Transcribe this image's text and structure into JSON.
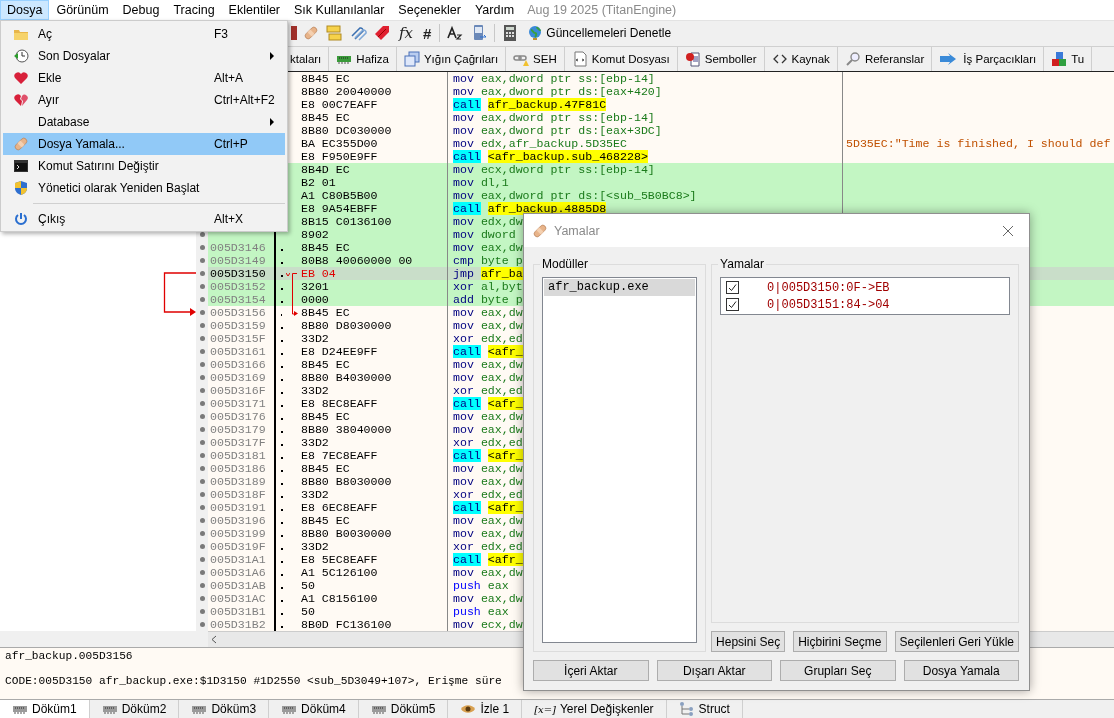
{
  "menu_bar": {
    "items": [
      {
        "label": "Dosya",
        "selected": true
      },
      {
        "label": "Görünüm",
        "selected": false
      },
      {
        "label": "Debug",
        "selected": false
      },
      {
        "label": "Tracing",
        "selected": false
      },
      {
        "label": "Eklentiler",
        "selected": false
      },
      {
        "label": "Sık Kullanılanlar",
        "selected": false
      },
      {
        "label": "Seçenekler",
        "selected": false
      },
      {
        "label": "Yardım",
        "selected": false
      }
    ],
    "build": "Aug 19 2025 (TitanEngine)"
  },
  "file_menu": [
    {
      "kind": "item",
      "label": "Aç",
      "shortcut": "F3",
      "submenu": false,
      "selected": false
    },
    {
      "kind": "item",
      "label": "Son Dosyalar",
      "submenu": true,
      "selected": false
    },
    {
      "kind": "item",
      "label": "Ekle",
      "shortcut": "Alt+A",
      "submenu": false,
      "selected": false
    },
    {
      "kind": "item",
      "label": "Ayır",
      "shortcut": "Ctrl+Alt+F2",
      "submenu": false,
      "selected": false
    },
    {
      "kind": "item",
      "label": "Database",
      "submenu": true,
      "selected": false
    },
    {
      "kind": "item",
      "label": "Dosya Yamala...",
      "shortcut": "Ctrl+P",
      "submenu": false,
      "selected": true
    },
    {
      "kind": "item",
      "label": "Komut Satırını Değiştir",
      "submenu": false,
      "selected": false
    },
    {
      "kind": "item",
      "label": "Yönetici olarak Yeniden Başlat",
      "submenu": false,
      "selected": false
    },
    {
      "kind": "separator"
    },
    {
      "kind": "item",
      "label": "Çıkış",
      "shortcut": "Alt+X",
      "submenu": false,
      "selected": false
    }
  ],
  "toolbar": {
    "glyphs": [
      "fx",
      "#"
    ],
    "update_button": "Güncellemeleri Denetle"
  },
  "top_tabs": [
    "ktaları",
    "Hafiza",
    "Yığın Çağrıları",
    "SEH",
    "Komut Dosyası",
    "Semboller",
    "Kaynak",
    "Referanslar",
    "İş Parçacıkları",
    "Tu"
  ],
  "disassembly": [
    {
      "bytes": "8B45 EC",
      "mnemonic": "mov",
      "operands": "eax,dword ptr ss:[ebp-14]",
      "kind": "plain",
      "traced": false,
      "selected": false,
      "patched": false,
      "jump_from": false,
      "jump_to": false
    },
    {
      "bytes": "8B80 20040000",
      "mnemonic": "mov",
      "operands": "eax,dword ptr ds:[eax+420]",
      "kind": "plain",
      "traced": false,
      "selected": false,
      "patched": false,
      "jump_from": false,
      "jump_to": false
    },
    {
      "bytes": "E8 00C7EAFF",
      "mnemonic": "call",
      "operands": "afr_backup.47F81C",
      "kind": "call",
      "traced": false,
      "selected": false,
      "patched": false,
      "jump_from": false,
      "jump_to": false
    },
    {
      "bytes": "8B45 EC",
      "mnemonic": "mov",
      "operands": "eax,dword ptr ss:[ebp-14]",
      "kind": "plain",
      "traced": false,
      "selected": false,
      "patched": false,
      "jump_from": false,
      "jump_to": false
    },
    {
      "bytes": "8B80 DC030000",
      "mnemonic": "mov",
      "operands": "eax,dword ptr ds:[eax+3DC]",
      "kind": "plain",
      "traced": false,
      "selected": false,
      "patched": false,
      "jump_from": false,
      "jump_to": false
    },
    {
      "bytes": "BA EC355D00",
      "mnemonic": "mov",
      "operands": "edx,afr_backup.5D35EC",
      "kind": "plain",
      "traced": false,
      "selected": false,
      "patched": false,
      "jump_from": false,
      "jump_to": false,
      "comment": "5D35EC:\"Time is finished, I should def"
    },
    {
      "bytes": "E8 F950E9FF",
      "mnemonic": "call",
      "operands": "<afr_backup.sub_468228>",
      "kind": "call",
      "traced": false,
      "selected": false,
      "patched": false,
      "jump_from": false,
      "jump_to": false
    },
    {
      "bytes": "8B4D EC",
      "mnemonic": "mov",
      "operands": "ecx,dword ptr ss:[ebp-14]",
      "kind": "plain",
      "traced": true,
      "selected": false,
      "patched": false,
      "jump_from": false,
      "jump_to": false
    },
    {
      "bytes": "B2 01",
      "mnemonic": "mov",
      "operands": "dl,1",
      "kind": "plain",
      "traced": true,
      "selected": false,
      "patched": false,
      "jump_from": false,
      "jump_to": false
    },
    {
      "bytes": "A1 C80B5B00",
      "mnemonic": "mov",
      "operands": "eax,dword ptr ds:[<sub_5B0BC8>]",
      "kind": "plain",
      "traced": true,
      "selected": false,
      "patched": false,
      "jump_from": false,
      "jump_to": false
    },
    {
      "bytes": "E8 9A54EBFF",
      "mnemonic": "call",
      "operands": "afr_backup.4885D8",
      "kind": "call",
      "traced": true,
      "selected": false,
      "patched": false,
      "jump_from": false,
      "jump_to": false
    },
    {
      "bytes": "8B15 C0136100",
      "mnemonic": "mov",
      "operands": "edx,dw",
      "kind": "plain",
      "traced": true,
      "selected": false,
      "patched": false,
      "jump_from": false,
      "jump_to": false
    },
    {
      "bytes": "8902",
      "mnemonic": "mov",
      "operands": "dword",
      "kind": "plain",
      "traced": true,
      "selected": false,
      "patched": false,
      "jump_from": false,
      "jump_to": false
    },
    {
      "address": "005D3146",
      "bytes": "8B45 EC",
      "mnemonic": "mov",
      "operands": "eax,dw",
      "kind": "plain",
      "traced": true,
      "selected": false,
      "patched": false,
      "jump_from": false,
      "jump_to": false
    },
    {
      "address": "005D3149",
      "bytes": "80B8 40060000 00",
      "mnemonic": "cmp",
      "operands": "byte p",
      "kind": "plain",
      "traced": true,
      "selected": false,
      "patched": false,
      "jump_from": false,
      "jump_to": false
    },
    {
      "address": "005D3150",
      "bytes": "EB 04",
      "mnemonic": "jmp",
      "operands": "afr_ba",
      "kind": "jmp",
      "traced": true,
      "selected": true,
      "patched": true,
      "jump_from": true,
      "jump_to": false
    },
    {
      "address": "005D3152",
      "bytes": "3201",
      "mnemonic": "xor",
      "operands": "al,byt",
      "kind": "plain",
      "traced": true,
      "selected": false,
      "patched": false,
      "jump_from": false,
      "jump_to": false
    },
    {
      "address": "005D3154",
      "bytes": "0000",
      "mnemonic": "add",
      "operands": "byte p",
      "kind": "plain",
      "traced": true,
      "selected": false,
      "patched": false,
      "jump_from": false,
      "jump_to": false
    },
    {
      "address": "005D3156",
      "bytes": "8B45 EC",
      "mnemonic": "mov",
      "operands": "eax,dw",
      "kind": "plain",
      "traced": false,
      "selected": false,
      "patched": false,
      "jump_from": false,
      "jump_to": true
    },
    {
      "address": "005D3159",
      "bytes": "8B80 D8030000",
      "mnemonic": "mov",
      "operands": "eax,dw",
      "kind": "plain",
      "traced": false,
      "selected": false,
      "patched": false,
      "jump_from": false,
      "jump_to": false
    },
    {
      "address": "005D315F",
      "bytes": "33D2",
      "mnemonic": "xor",
      "operands": "edx,ed",
      "kind": "plain",
      "traced": false,
      "selected": false,
      "patched": false,
      "jump_from": false,
      "jump_to": false
    },
    {
      "address": "005D3161",
      "bytes": "E8 D24EE9FF",
      "mnemonic": "call",
      "operands": "<afr_",
      "kind": "call",
      "traced": false,
      "selected": false,
      "patched": false,
      "jump_from": false,
      "jump_to": false
    },
    {
      "address": "005D3166",
      "bytes": "8B45 EC",
      "mnemonic": "mov",
      "operands": "eax,dw",
      "kind": "plain",
      "traced": false,
      "selected": false,
      "patched": false,
      "jump_from": false,
      "jump_to": false
    },
    {
      "address": "005D3169",
      "bytes": "8B80 B4030000",
      "mnemonic": "mov",
      "operands": "eax,dw",
      "kind": "plain",
      "traced": false,
      "selected": false,
      "patched": false,
      "jump_from": false,
      "jump_to": false
    },
    {
      "address": "005D316F",
      "bytes": "33D2",
      "mnemonic": "xor",
      "operands": "edx,ed",
      "kind": "plain",
      "traced": false,
      "selected": false,
      "patched": false,
      "jump_from": false,
      "jump_to": false
    },
    {
      "address": "005D3171",
      "bytes": "E8 8EC8EAFF",
      "mnemonic": "call",
      "operands": "<afr_",
      "kind": "call",
      "traced": false,
      "selected": false,
      "patched": false,
      "jump_from": false,
      "jump_to": false
    },
    {
      "address": "005D3176",
      "bytes": "8B45 EC",
      "mnemonic": "mov",
      "operands": "eax,dw",
      "kind": "plain",
      "traced": false,
      "selected": false,
      "patched": false,
      "jump_from": false,
      "jump_to": false
    },
    {
      "address": "005D3179",
      "bytes": "8B80 38040000",
      "mnemonic": "mov",
      "operands": "eax,dw",
      "kind": "plain",
      "traced": false,
      "selected": false,
      "patched": false,
      "jump_from": false,
      "jump_to": false
    },
    {
      "address": "005D317F",
      "bytes": "33D2",
      "mnemonic": "xor",
      "operands": "edx,ed",
      "kind": "plain",
      "traced": false,
      "selected": false,
      "patched": false,
      "jump_from": false,
      "jump_to": false
    },
    {
      "address": "005D3181",
      "bytes": "E8 7EC8EAFF",
      "mnemonic": "call",
      "operands": "<afr_",
      "kind": "call",
      "traced": false,
      "selected": false,
      "patched": false,
      "jump_from": false,
      "jump_to": false
    },
    {
      "address": "005D3186",
      "bytes": "8B45 EC",
      "mnemonic": "mov",
      "operands": "eax,dw",
      "kind": "plain",
      "traced": false,
      "selected": false,
      "patched": false,
      "jump_from": false,
      "jump_to": false
    },
    {
      "address": "005D3189",
      "bytes": "8B80 B8030000",
      "mnemonic": "mov",
      "operands": "eax,dw",
      "kind": "plain",
      "traced": false,
      "selected": false,
      "patched": false,
      "jump_from": false,
      "jump_to": false
    },
    {
      "address": "005D318F",
      "bytes": "33D2",
      "mnemonic": "xor",
      "operands": "edx,ed",
      "kind": "plain",
      "traced": false,
      "selected": false,
      "patched": false,
      "jump_from": false,
      "jump_to": false
    },
    {
      "address": "005D3191",
      "bytes": "E8 6EC8EAFF",
      "mnemonic": "call",
      "operands": "<afr_",
      "kind": "call",
      "traced": false,
      "selected": false,
      "patched": false,
      "jump_from": false,
      "jump_to": false
    },
    {
      "address": "005D3196",
      "bytes": "8B45 EC",
      "mnemonic": "mov",
      "operands": "eax,dw",
      "kind": "plain",
      "traced": false,
      "selected": false,
      "patched": false,
      "jump_from": false,
      "jump_to": false
    },
    {
      "address": "005D3199",
      "bytes": "8B80 B0030000",
      "mnemonic": "mov",
      "operands": "eax,dw",
      "kind": "plain",
      "traced": false,
      "selected": false,
      "patched": false,
      "jump_from": false,
      "jump_to": false
    },
    {
      "address": "005D319F",
      "bytes": "33D2",
      "mnemonic": "xor",
      "operands": "edx,ed",
      "kind": "plain",
      "traced": false,
      "selected": false,
      "patched": false,
      "jump_from": false,
      "jump_to": false
    },
    {
      "address": "005D31A1",
      "bytes": "E8 5EC8EAFF",
      "mnemonic": "call",
      "operands": "<afr_",
      "kind": "call",
      "traced": false,
      "selected": false,
      "patched": false,
      "jump_from": false,
      "jump_to": false
    },
    {
      "address": "005D31A6",
      "bytes": "A1 5C126100",
      "mnemonic": "mov",
      "operands": "eax,dw",
      "kind": "plain",
      "traced": false,
      "selected": false,
      "patched": false,
      "jump_from": false,
      "jump_to": false
    },
    {
      "address": "005D31AB",
      "bytes": "50",
      "mnemonic": "push",
      "operands": "eax",
      "kind": "push",
      "traced": false,
      "selected": false,
      "patched": false,
      "jump_from": false,
      "jump_to": false
    },
    {
      "address": "005D31AC",
      "bytes": "A1 C8156100",
      "mnemonic": "mov",
      "operands": "eax,dw",
      "kind": "plain",
      "traced": false,
      "selected": false,
      "patched": false,
      "jump_from": false,
      "jump_to": false
    },
    {
      "address": "005D31B1",
      "bytes": "50",
      "mnemonic": "push",
      "operands": "eax",
      "kind": "push",
      "traced": false,
      "selected": false,
      "patched": false,
      "jump_from": false,
      "jump_to": false
    },
    {
      "address": "005D31B2",
      "bytes": "8B0D FC136100",
      "mnemonic": "mov",
      "operands": "ecx,dw",
      "kind": "plain",
      "traced": false,
      "selected": false,
      "patched": false,
      "jump_from": false,
      "jump_to": false
    }
  ],
  "info_pane": [
    "afr_backup.005D3156",
    "CODE:005D3150 afr_backup.exe:$1D3150 #1D2550 <sub_5D3049+107>, Erişme süre"
  ],
  "bottom_tabs": [
    {
      "label": "Döküm1",
      "selected": true
    },
    {
      "label": "Döküm2",
      "selected": false
    },
    {
      "label": "Döküm3",
      "selected": false
    },
    {
      "label": "Döküm4",
      "selected": false
    },
    {
      "label": "Döküm5",
      "selected": false
    },
    {
      "label": "İzle 1",
      "selected": false
    },
    {
      "label": "Yerel Değişkenler",
      "icon_text": "[x=]",
      "selected": false
    },
    {
      "label": "Struct",
      "selected": false
    }
  ],
  "patch_dialog": {
    "title": "Yamalar",
    "modules_label": "Modüller",
    "modules": [
      {
        "name": "afr_backup.exe",
        "selected": true
      }
    ],
    "patches_label": "Yamalar",
    "patches": [
      {
        "text": "0|005D3150:0F->EB",
        "checked": true
      },
      {
        "text": "0|005D3151:84->04",
        "checked": true
      }
    ],
    "list_buttons": [
      "Hepsini Seç",
      "Hiçbirini Seçme",
      "Seçilenleri Geri Yükle"
    ],
    "buttons": [
      "İçeri Aktar",
      "Dışarı Aktar",
      "Grupları Seç",
      "Dosya Yamala"
    ]
  }
}
